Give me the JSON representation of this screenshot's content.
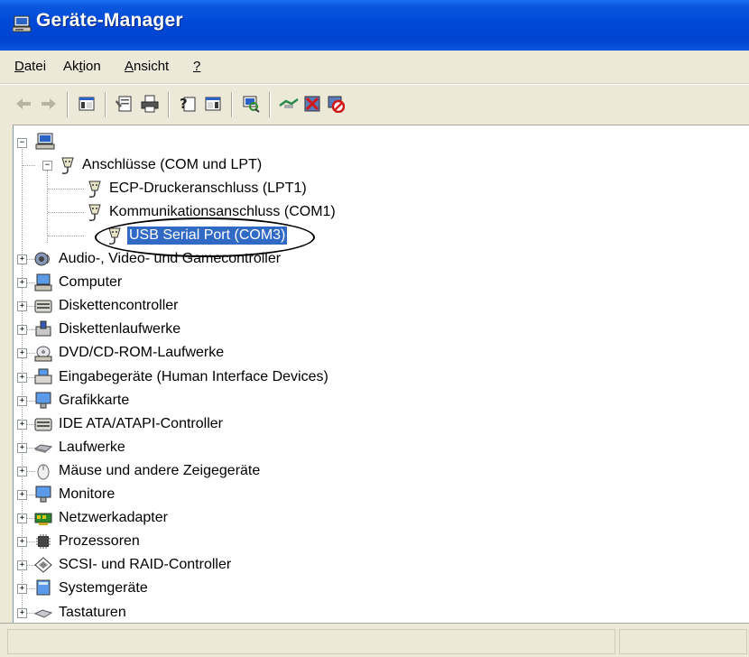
{
  "window": {
    "title": "Geräte-Manager",
    "title_icon": "computer-monitor-icon"
  },
  "menu": {
    "items": [
      {
        "label": "Datei",
        "accel": "D"
      },
      {
        "label": "Aktion",
        "accel": "t"
      },
      {
        "label": "Ansicht",
        "accel": "A"
      },
      {
        "label": "?",
        "accel": "?"
      }
    ]
  },
  "toolbar": {
    "buttons": [
      {
        "name": "back",
        "icon": "back-arrow-icon"
      },
      {
        "name": "forward",
        "icon": "forward-arrow-icon"
      },
      {
        "name": "show-hide-console-tree",
        "icon": "console-tree-icon"
      },
      {
        "name": "properties",
        "icon": "properties-icon"
      },
      {
        "name": "print",
        "icon": "printer-icon"
      },
      {
        "name": "help",
        "icon": "help-icon"
      },
      {
        "name": "action-pane",
        "icon": "action-pane-icon"
      },
      {
        "name": "scan-hardware",
        "icon": "scan-hardware-icon"
      },
      {
        "name": "update-driver",
        "icon": "update-driver-icon"
      },
      {
        "name": "uninstall",
        "icon": "uninstall-icon"
      },
      {
        "name": "disable",
        "icon": "disable-icon"
      }
    ]
  },
  "tree": {
    "root": {
      "label": "",
      "icon": "computer-icon",
      "expanded": true
    },
    "ports": {
      "label": "Anschlüsse (COM und LPT)",
      "icon": "port-connector-icon",
      "expanded": true,
      "children": [
        {
          "label": "ECP-Druckeranschluss (LPT1)",
          "icon": "port-connector-icon"
        },
        {
          "label": "Kommunikationsanschluss (COM1)",
          "icon": "port-connector-icon"
        },
        {
          "label": "USB Serial Port (COM3)",
          "icon": "port-connector-icon",
          "selected": true
        }
      ]
    },
    "categories": [
      {
        "label": "Audio-, Video- und Gamecontroller",
        "icon": "speaker-icon"
      },
      {
        "label": "Computer",
        "icon": "computer-icon"
      },
      {
        "label": "Diskettencontroller",
        "icon": "disk-controller-icon"
      },
      {
        "label": "Diskettenlaufwerke",
        "icon": "floppy-drive-icon"
      },
      {
        "label": "DVD/CD-ROM-Laufwerke",
        "icon": "cd-drive-icon"
      },
      {
        "label": "Eingabegeräte (Human Interface Devices)",
        "icon": "hid-icon"
      },
      {
        "label": "Grafikkarte",
        "icon": "display-adapter-icon"
      },
      {
        "label": "IDE ATA/ATAPI-Controller",
        "icon": "ide-controller-icon"
      },
      {
        "label": "Laufwerke",
        "icon": "hard-drive-icon"
      },
      {
        "label": "Mäuse und andere Zeigegeräte",
        "icon": "mouse-icon"
      },
      {
        "label": "Monitore",
        "icon": "monitor-icon"
      },
      {
        "label": "Netzwerkadapter",
        "icon": "network-adapter-icon"
      },
      {
        "label": "Prozessoren",
        "icon": "processor-icon"
      },
      {
        "label": "SCSI- und RAID-Controller",
        "icon": "scsi-controller-icon"
      },
      {
        "label": "Systemgeräte",
        "icon": "system-devices-icon"
      },
      {
        "label": "Tastaturen",
        "icon": "keyboard-icon"
      }
    ]
  },
  "annotation": {
    "shape": "ellipse",
    "target": "USB Serial Port (COM3)"
  },
  "colors": {
    "titlebar": "#0048d8",
    "selection": "#316ac5",
    "chrome": "#ece9d8"
  }
}
